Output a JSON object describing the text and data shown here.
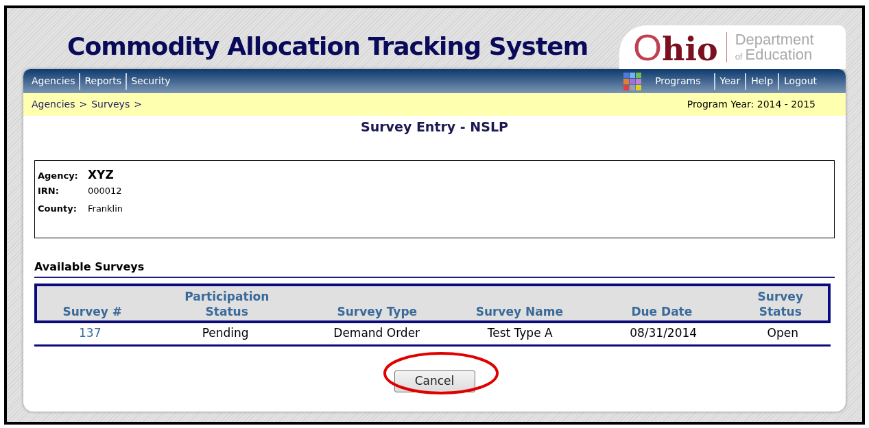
{
  "header": {
    "title": "Commodity Allocation Tracking System",
    "logo": {
      "state": "Ohio",
      "department": "Department",
      "of": "of",
      "education": "Education"
    }
  },
  "nav": {
    "left": [
      "Agencies",
      "Reports",
      "Security"
    ],
    "right": [
      "Programs",
      "Year",
      "Help",
      "Logout"
    ]
  },
  "breadcrumb": {
    "items": [
      "Agencies",
      "Surveys"
    ],
    "separator": ">",
    "program_year": "Program Year: 2014 - 2015"
  },
  "page_title": "Survey Entry - NSLP",
  "agency": {
    "fields": [
      {
        "label": "Agency:",
        "value": "XYZ",
        "kind": "large"
      },
      {
        "label": "IRN:",
        "value": "000012",
        "kind": "normal"
      },
      {
        "label": "County:",
        "value": "Franklin",
        "kind": "normal"
      }
    ]
  },
  "surveys": {
    "title": "Available Surveys",
    "columns": [
      "Survey #",
      "Participation Status",
      "Survey Type",
      "Survey Name",
      "Due Date",
      "Survey Status"
    ],
    "rows": [
      {
        "cells": [
          "137",
          "Pending",
          "Demand Order",
          "Test Type A",
          "08/31/2014",
          "Open"
        ]
      }
    ]
  },
  "buttons": [
    "Cancel"
  ]
}
